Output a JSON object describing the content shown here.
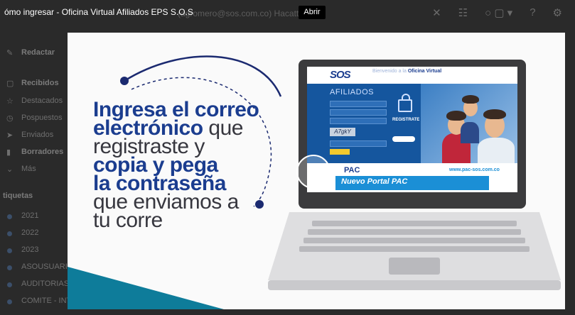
{
  "video": {
    "title": "ómo ingresar - Oficina Virtual Afiliados EPS S.O.S",
    "open_button": "Abrir",
    "headline_bold_1": "Ingresa el correo",
    "headline_bold_2": "electrónico",
    "headline_light_2": " que",
    "headline_light_3": "registraste y",
    "headline_bold_4": "copia y pega",
    "headline_bold_5": "la contraseña",
    "headline_light_6": "que enviamos a",
    "headline_light_7": "tu corre"
  },
  "portal": {
    "logo": "SOS",
    "welcome_prefix": "Bienvenido a la ",
    "welcome_name": "Oficina Virtual",
    "section_title": "AFILIADOS",
    "captcha": "A7gkY",
    "register_label": "REGISTRATE",
    "pac_logo": "PAC",
    "pac_site": "www.pac-sos.com.co",
    "pac_portal": "Nuevo Portal PAC"
  },
  "background": {
    "top_text": "(agromero@sos.com.co) Hacatto",
    "compose": "Redactar",
    "nav_items": [
      "Recibidos",
      "Destacados",
      "Pospuestos",
      "Enviados",
      "Borradores",
      "Más"
    ],
    "labels_title": "tiquetas",
    "labels": [
      "2021",
      "2022",
      "2023",
      "ASOUSUARIO",
      "AUDITORIAS",
      "COMITE - INT"
    ]
  },
  "colors": {
    "headline_blue": "#1b3d8f",
    "accent_teal": "#0e7c9a",
    "portal_blue": "#15569e"
  }
}
